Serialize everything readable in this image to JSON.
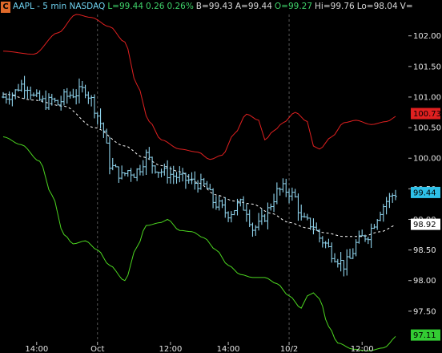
{
  "header": {
    "badge": "C",
    "symbol": "AAPL - 5 min  NASDAQ",
    "last": "L=99.44",
    "change": "0.26",
    "change_pct": "0.26%",
    "bid": "B=99.43",
    "ask": "A=99.44",
    "open": "O=99.27",
    "high": "Hi=99.76",
    "low": "Lo=98.04",
    "vol": "V="
  },
  "colors": {
    "background": "#000000",
    "price": "#8fd3ec",
    "upper_band": "#e02020",
    "lower_band": "#4cd620",
    "middle_band": "#ffffff",
    "last_tag": "#2ec0e8",
    "upper_tag": "#e02020",
    "lower_tag": "#33cc33",
    "mid_tag": "#ffffff",
    "grid": "#555555"
  },
  "chart_data": {
    "type": "ohlc",
    "title": "",
    "xlabel": "",
    "ylabel": "",
    "ylim": [
      97.0,
      102.35
    ],
    "y_ticks": [
      {
        "value": 97.5,
        "label": "97.50"
      },
      {
        "value": 98.0,
        "label": "98.00"
      },
      {
        "value": 98.5,
        "label": "98.50"
      },
      {
        "value": 99.0,
        "label": "99.00"
      },
      {
        "value": 99.5,
        "label": "99.50"
      },
      {
        "value": 100.0,
        "label": "100.00"
      },
      {
        "value": 100.5,
        "label": "100.50"
      },
      {
        "value": 101.0,
        "label": "101.00"
      },
      {
        "value": 101.5,
        "label": "101.50"
      },
      {
        "value": 102.0,
        "label": "102.00"
      }
    ],
    "bar_count": 130,
    "x_ticks": [
      {
        "index": 11,
        "label": "14:00"
      },
      {
        "index": 31,
        "label": "Oct",
        "session_break": true
      },
      {
        "index": 55,
        "label": "12:00"
      },
      {
        "index": 74,
        "label": "14:00"
      },
      {
        "index": 94,
        "label": "10/2",
        "session_break": true
      },
      {
        "index": 118,
        "label": "12:00"
      }
    ],
    "series": [
      {
        "name": "Upper Band",
        "color_key": "upper_band",
        "anchors": [
          [
            0,
            101.75
          ],
          [
            10,
            101.7
          ],
          [
            18,
            102.05
          ],
          [
            24,
            102.35
          ],
          [
            29,
            102.3
          ],
          [
            35,
            102.15
          ],
          [
            40,
            101.9
          ],
          [
            44,
            101.2
          ],
          [
            48,
            100.6
          ],
          [
            52,
            100.3
          ],
          [
            58,
            100.15
          ],
          [
            64,
            100.1
          ],
          [
            68,
            99.98
          ],
          [
            72,
            100.05
          ],
          [
            76,
            100.4
          ],
          [
            80,
            100.72
          ],
          [
            84,
            100.62
          ],
          [
            86,
            100.3
          ],
          [
            89,
            100.45
          ],
          [
            92,
            100.58
          ],
          [
            96,
            100.75
          ],
          [
            100,
            100.6
          ],
          [
            102,
            100.2
          ],
          [
            104,
            100.15
          ],
          [
            108,
            100.35
          ],
          [
            112,
            100.58
          ],
          [
            116,
            100.62
          ],
          [
            121,
            100.55
          ],
          [
            126,
            100.6
          ],
          [
            130,
            100.7
          ]
        ]
      },
      {
        "name": "Lower Band",
        "color_key": "lower_band",
        "anchors": [
          [
            0,
            100.35
          ],
          [
            6,
            100.22
          ],
          [
            12,
            99.95
          ],
          [
            16,
            99.4
          ],
          [
            20,
            98.75
          ],
          [
            23,
            98.6
          ],
          [
            27,
            98.65
          ],
          [
            31,
            98.5
          ],
          [
            35,
            98.25
          ],
          [
            40,
            98.0
          ],
          [
            44,
            98.55
          ],
          [
            47,
            98.9
          ],
          [
            52,
            98.95
          ],
          [
            54,
            99.0
          ],
          [
            58,
            98.82
          ],
          [
            62,
            98.8
          ],
          [
            66,
            98.7
          ],
          [
            70,
            98.5
          ],
          [
            74,
            98.25
          ],
          [
            78,
            98.1
          ],
          [
            82,
            98.05
          ],
          [
            86,
            98.05
          ],
          [
            90,
            97.95
          ],
          [
            94,
            97.75
          ],
          [
            98,
            97.55
          ],
          [
            100,
            97.75
          ],
          [
            102,
            97.8
          ],
          [
            104,
            97.7
          ],
          [
            107,
            97.25
          ],
          [
            110,
            96.98
          ],
          [
            115,
            96.88
          ],
          [
            120,
            96.85
          ],
          [
            125,
            96.9
          ],
          [
            130,
            97.11
          ]
        ]
      },
      {
        "name": "Middle Band",
        "color_key": "middle_band",
        "dashed": true,
        "anchors": [
          [
            0,
            101.05
          ],
          [
            10,
            100.95
          ],
          [
            20,
            100.85
          ],
          [
            30,
            100.5
          ],
          [
            40,
            100.2
          ],
          [
            46,
            100.02
          ],
          [
            52,
            99.88
          ],
          [
            58,
            99.78
          ],
          [
            64,
            99.6
          ],
          [
            70,
            99.4
          ],
          [
            76,
            99.3
          ],
          [
            82,
            99.25
          ],
          [
            88,
            99.1
          ],
          [
            94,
            98.95
          ],
          [
            100,
            98.86
          ],
          [
            106,
            98.78
          ],
          [
            112,
            98.72
          ],
          [
            118,
            98.72
          ],
          [
            124,
            98.8
          ],
          [
            130,
            98.92
          ]
        ]
      },
      {
        "name": "Price",
        "color_key": "price",
        "ohlc": true,
        "anchors": [
          [
            0,
            101.0
          ],
          [
            3,
            101.05
          ],
          [
            6,
            101.2
          ],
          [
            8,
            101.18
          ],
          [
            10,
            101.0
          ],
          [
            12,
            100.95
          ],
          [
            14,
            100.9
          ],
          [
            16,
            100.95
          ],
          [
            18,
            100.88
          ],
          [
            20,
            101.0
          ],
          [
            23,
            101.05
          ],
          [
            27,
            101.12
          ],
          [
            29,
            100.95
          ],
          [
            31,
            100.7
          ],
          [
            33,
            100.45
          ],
          [
            35,
            99.9
          ],
          [
            37,
            99.8
          ],
          [
            39,
            99.7
          ],
          [
            41,
            99.8
          ],
          [
            43,
            99.75
          ],
          [
            45,
            99.85
          ],
          [
            47,
            100.05
          ],
          [
            49,
            99.9
          ],
          [
            51,
            99.8
          ],
          [
            54,
            99.75
          ],
          [
            57,
            99.7
          ],
          [
            60,
            99.65
          ],
          [
            63,
            99.6
          ],
          [
            66,
            99.55
          ],
          [
            70,
            99.25
          ],
          [
            74,
            99.1
          ],
          [
            78,
            99.25
          ],
          [
            80,
            99.15
          ],
          [
            82,
            98.85
          ],
          [
            84,
            98.9
          ],
          [
            86,
            99.05
          ],
          [
            88,
            99.25
          ],
          [
            90,
            99.45
          ],
          [
            92,
            99.5
          ],
          [
            94,
            99.45
          ],
          [
            96,
            99.35
          ],
          [
            98,
            99.0
          ],
          [
            100,
            98.95
          ],
          [
            102,
            98.9
          ],
          [
            104,
            98.7
          ],
          [
            106,
            98.6
          ],
          [
            108,
            98.45
          ],
          [
            110,
            98.35
          ],
          [
            112,
            98.25
          ],
          [
            114,
            98.35
          ],
          [
            116,
            98.6
          ],
          [
            118,
            98.7
          ],
          [
            120,
            98.75
          ],
          [
            122,
            98.95
          ],
          [
            124,
            99.15
          ],
          [
            126,
            99.3
          ],
          [
            128,
            99.4
          ],
          [
            130,
            99.44
          ]
        ],
        "wiggle": 0.13,
        "seed": 7
      }
    ],
    "last_labels": [
      {
        "value": 100.73,
        "label": "100.73",
        "color_key": "upper_tag",
        "text": "#000000"
      },
      {
        "value": 99.44,
        "label": "99.44",
        "color_key": "last_tag",
        "text": "#000000"
      },
      {
        "value": 98.92,
        "label": "98.92",
        "color_key": "mid_tag",
        "text": "#000000"
      },
      {
        "value": 97.11,
        "label": "97.11",
        "color_key": "lower_tag",
        "text": "#000000"
      }
    ]
  }
}
